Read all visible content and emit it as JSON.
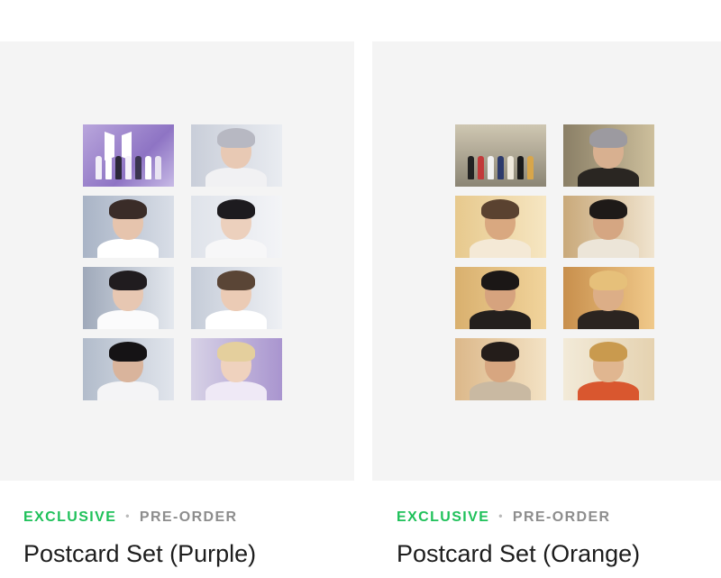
{
  "products": [
    {
      "badge": "EXCLUSIVE",
      "separator": "•",
      "status": "PRE-ORDER",
      "title": "Postcard Set (Purple)",
      "accent": "#1fc15a",
      "theme": "purple"
    },
    {
      "badge": "EXCLUSIVE",
      "separator": "•",
      "status": "PRE-ORDER",
      "title": "Postcard Set (Orange)",
      "accent": "#1fc15a",
      "theme": "orange"
    }
  ]
}
